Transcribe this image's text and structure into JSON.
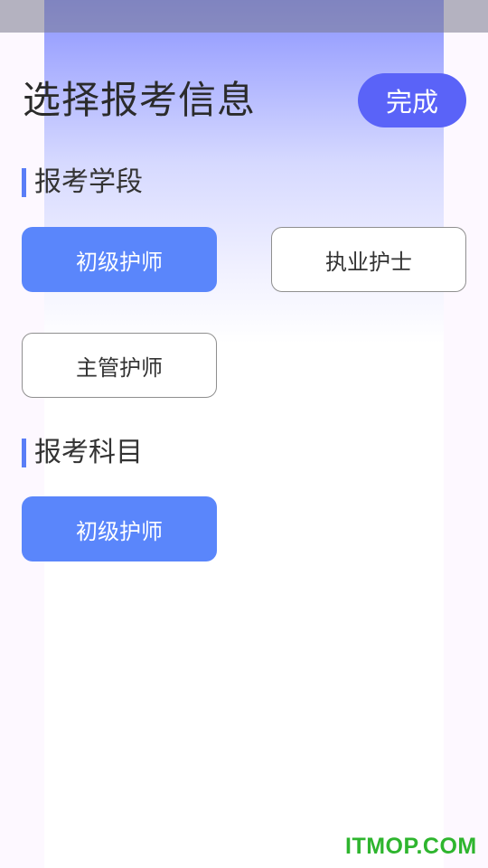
{
  "header": {
    "title": "选择报考信息",
    "done_label": "完成"
  },
  "sections": [
    {
      "title": "报考学段",
      "options": [
        {
          "label": "初级护师",
          "selected": true
        },
        {
          "label": "执业护士",
          "selected": false
        },
        {
          "label": "主管护师",
          "selected": false
        }
      ]
    },
    {
      "title": "报考科目",
      "options": [
        {
          "label": "初级护师",
          "selected": true
        }
      ]
    }
  ],
  "watermark": "ITMOP.COM",
  "colors": {
    "accent": "#5a63f8",
    "selected_option": "#5a86fb",
    "section_bar": "#5a7ef7",
    "watermark": "#2eb52e"
  }
}
